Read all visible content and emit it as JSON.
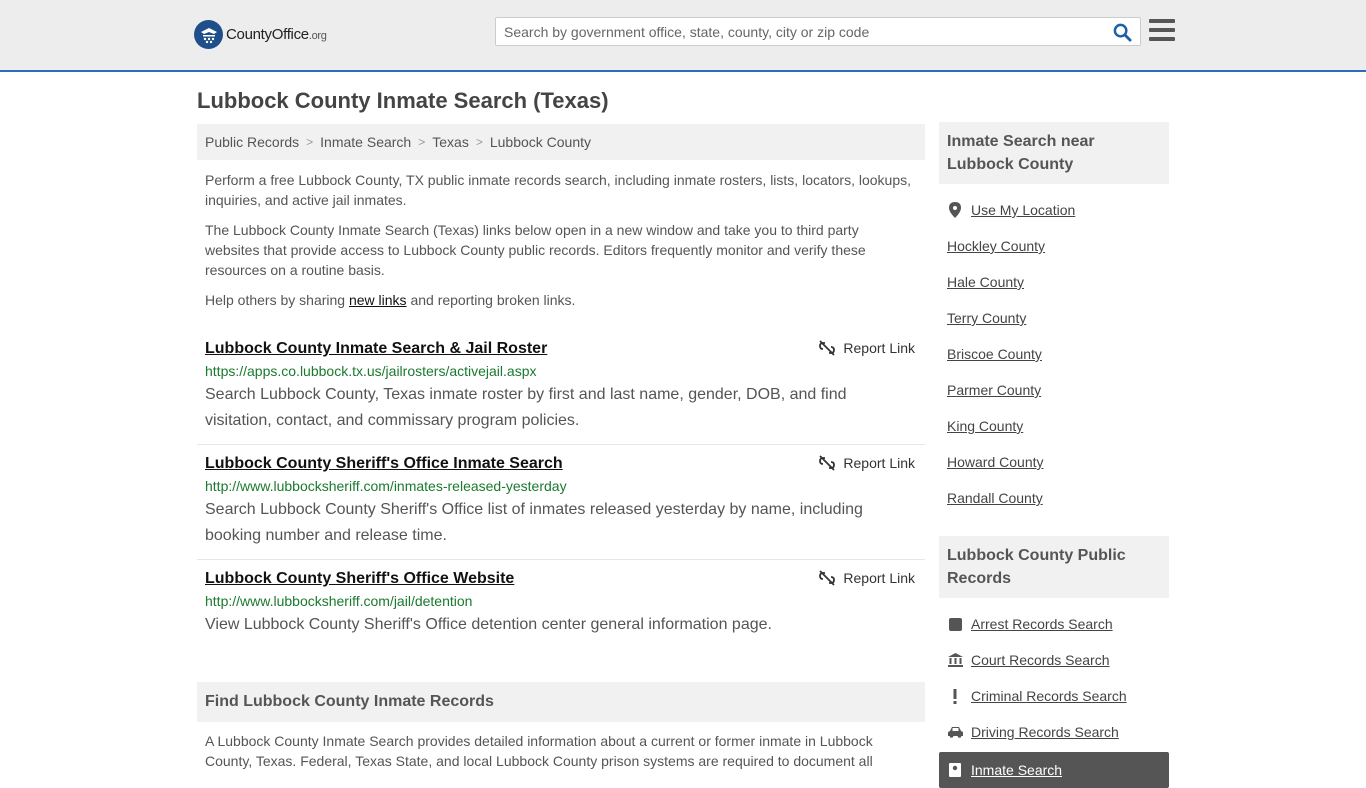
{
  "header": {
    "logo_main": "CountyOffice",
    "logo_suffix": ".org",
    "search_placeholder": "Search by government office, state, county, city or zip code"
  },
  "page_title": "Lubbock County Inmate Search (Texas)",
  "breadcrumb": [
    "Public Records",
    "Inmate Search",
    "Texas",
    "Lubbock County"
  ],
  "intro": {
    "p1": "Perform a free Lubbock County, TX public inmate records search, including inmate rosters, lists, locators, lookups, inquiries, and active jail inmates.",
    "p2": "The Lubbock County Inmate Search (Texas) links below open in a new window and take you to third party websites that provide access to Lubbock County public records. Editors frequently monitor and verify these resources on a routine basis.",
    "p3_before": "Help others by sharing ",
    "p3_link": "new links",
    "p3_after": " and reporting broken links."
  },
  "results": [
    {
      "title": "Lubbock County Inmate Search & Jail Roster",
      "url": "https://apps.co.lubbock.tx.us/jailrosters/activejail.aspx",
      "desc": "Search Lubbock County, Texas inmate roster by first and last name, gender, DOB, and find visitation, contact, and commissary program policies.",
      "report": "Report Link"
    },
    {
      "title": "Lubbock County Sheriff's Office Inmate Search",
      "url": "http://www.lubbocksheriff.com/inmates-released-yesterday",
      "desc": "Search Lubbock County Sheriff's Office list of inmates released yesterday by name, including booking number and release time.",
      "report": "Report Link"
    },
    {
      "title": "Lubbock County Sheriff's Office Website",
      "url": "http://www.lubbocksheriff.com/jail/detention",
      "desc": "View Lubbock County Sheriff's Office detention center general information page.",
      "report": "Report Link"
    }
  ],
  "find_section": {
    "title": "Find Lubbock County Inmate Records",
    "text": "A Lubbock County Inmate Search provides detailed information about a current or former inmate in Lubbock County, Texas. Federal, Texas State, and local Lubbock County prison systems are required to document all"
  },
  "sidebar": {
    "nearby_title": "Inmate Search near Lubbock County",
    "use_location": "Use My Location",
    "counties": [
      "Hockley County",
      "Hale County",
      "Terry County",
      "Briscoe County",
      "Parmer County",
      "King County",
      "Howard County",
      "Randall County"
    ],
    "records_title": "Lubbock County Public Records",
    "records": [
      {
        "label": "Arrest Records Search",
        "icon": "square-icon"
      },
      {
        "label": "Court Records Search",
        "icon": "courthouse-icon"
      },
      {
        "label": "Criminal Records Search",
        "icon": "exclamation-icon"
      },
      {
        "label": "Driving Records Search",
        "icon": "car-icon"
      }
    ],
    "active_record": "Inmate Search"
  }
}
